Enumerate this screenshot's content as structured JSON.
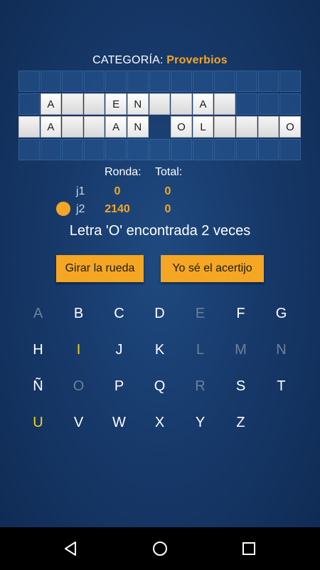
{
  "category": {
    "label": "CATEGORÍA:",
    "value": "Proverbios"
  },
  "board": {
    "rows": [
      [
        {
          "s": "empty",
          "c": ""
        },
        {
          "s": "empty",
          "c": ""
        },
        {
          "s": "empty",
          "c": ""
        },
        {
          "s": "empty",
          "c": ""
        },
        {
          "s": "empty",
          "c": ""
        },
        {
          "s": "empty",
          "c": ""
        },
        {
          "s": "empty",
          "c": ""
        },
        {
          "s": "empty",
          "c": ""
        },
        {
          "s": "empty",
          "c": ""
        },
        {
          "s": "empty",
          "c": ""
        },
        {
          "s": "empty",
          "c": ""
        },
        {
          "s": "empty",
          "c": ""
        },
        {
          "s": "empty",
          "c": ""
        }
      ],
      [
        {
          "s": "empty",
          "c": ""
        },
        {
          "s": "shown",
          "c": "A"
        },
        {
          "s": "hidden",
          "c": ""
        },
        {
          "s": "hidden",
          "c": ""
        },
        {
          "s": "shown",
          "c": "E"
        },
        {
          "s": "shown",
          "c": "N"
        },
        {
          "s": "hidden",
          "c": ""
        },
        {
          "s": "hidden",
          "c": ""
        },
        {
          "s": "shown",
          "c": "A"
        },
        {
          "s": "hidden",
          "c": ""
        },
        {
          "s": "empty",
          "c": ""
        },
        {
          "s": "empty",
          "c": ""
        },
        {
          "s": "empty",
          "c": ""
        }
      ],
      [
        {
          "s": "hidden",
          "c": ""
        },
        {
          "s": "shown",
          "c": "A"
        },
        {
          "s": "hidden",
          "c": ""
        },
        {
          "s": "hidden",
          "c": ""
        },
        {
          "s": "shown",
          "c": "A"
        },
        {
          "s": "shown",
          "c": "N"
        },
        {
          "s": "blank",
          "c": ""
        },
        {
          "s": "shown",
          "c": "O"
        },
        {
          "s": "shown",
          "c": "L"
        },
        {
          "s": "hidden",
          "c": ""
        },
        {
          "s": "hidden",
          "c": ""
        },
        {
          "s": "hidden",
          "c": ""
        },
        {
          "s": "shown",
          "c": "O"
        }
      ],
      [
        {
          "s": "empty",
          "c": ""
        },
        {
          "s": "empty",
          "c": ""
        },
        {
          "s": "empty",
          "c": ""
        },
        {
          "s": "empty",
          "c": ""
        },
        {
          "s": "empty",
          "c": ""
        },
        {
          "s": "empty",
          "c": ""
        },
        {
          "s": "empty",
          "c": ""
        },
        {
          "s": "empty",
          "c": ""
        },
        {
          "s": "empty",
          "c": ""
        },
        {
          "s": "empty",
          "c": ""
        },
        {
          "s": "empty",
          "c": ""
        },
        {
          "s": "empty",
          "c": ""
        },
        {
          "s": "empty",
          "c": ""
        }
      ]
    ]
  },
  "scores": {
    "round_header": "Ronda:",
    "total_header": "Total:",
    "players": [
      {
        "name": "j1",
        "round": "0",
        "total": "0"
      },
      {
        "name": "j2",
        "round": "2140",
        "total": "0"
      }
    ]
  },
  "message": "Letra 'O' encontrada 2 veces",
  "buttons": {
    "spin": "Girar la rueda",
    "solve": "Yo sé el acertijo"
  },
  "keyboard": {
    "rows": [
      [
        {
          "l": "A",
          "st": "used"
        },
        {
          "l": "B",
          "st": "available"
        },
        {
          "l": "C",
          "st": "available"
        },
        {
          "l": "D",
          "st": "available"
        },
        {
          "l": "E",
          "st": "used"
        },
        {
          "l": "F",
          "st": "available"
        },
        {
          "l": "G",
          "st": "available"
        }
      ],
      [
        {
          "l": "H",
          "st": "available"
        },
        {
          "l": "I",
          "st": "found"
        },
        {
          "l": "J",
          "st": "available"
        },
        {
          "l": "K",
          "st": "available"
        },
        {
          "l": "L",
          "st": "used"
        },
        {
          "l": "M",
          "st": "used"
        },
        {
          "l": "N",
          "st": "used"
        }
      ],
      [
        {
          "l": "Ñ",
          "st": "available"
        },
        {
          "l": "O",
          "st": "used"
        },
        {
          "l": "P",
          "st": "available"
        },
        {
          "l": "Q",
          "st": "available"
        },
        {
          "l": "R",
          "st": "used"
        },
        {
          "l": "S",
          "st": "available"
        },
        {
          "l": "T",
          "st": "available"
        }
      ],
      [
        {
          "l": "U",
          "st": "found"
        },
        {
          "l": "V",
          "st": "available"
        },
        {
          "l": "W",
          "st": "available"
        },
        {
          "l": "X",
          "st": "available"
        },
        {
          "l": "Y",
          "st": "available"
        },
        {
          "l": "Z",
          "st": "available"
        }
      ]
    ]
  },
  "colors": {
    "accent": "#f5a623",
    "found_letter": "#f3d21e",
    "used_letter": "#6d8099",
    "background": "#17396a"
  },
  "navbar": {
    "icons": [
      "back-icon",
      "home-icon",
      "recents-icon"
    ]
  }
}
